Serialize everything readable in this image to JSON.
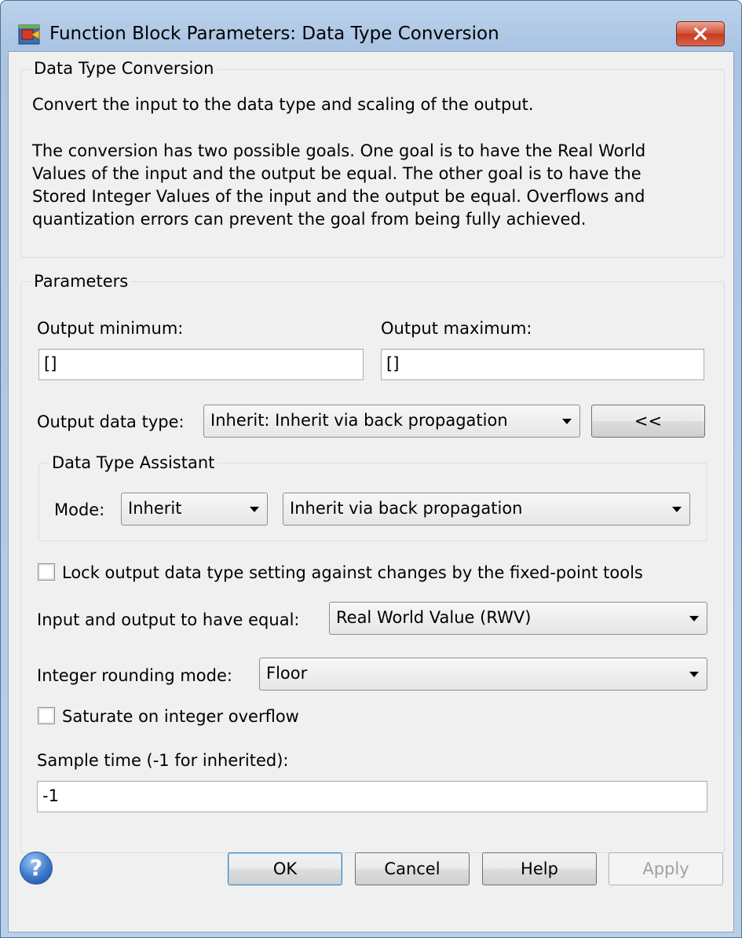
{
  "window": {
    "title": "Function Block Parameters: Data Type Conversion"
  },
  "description_group": {
    "title": "Data Type Conversion",
    "line1": "Convert the input to the data type and scaling of the output.",
    "para2_line1": "The conversion has two possible goals. One goal is to have the Real World",
    "para2_line2": "Values of the input and the output be equal.  The other goal is to have the",
    "para2_line3": "Stored Integer Values of the input and the output be equal.  Overflows and",
    "para2_line4": "quantization errors can prevent the goal from being fully achieved."
  },
  "parameters": {
    "title": "Parameters",
    "output_minimum_label": "Output minimum:",
    "output_minimum_value": "[]",
    "output_maximum_label": "Output maximum:",
    "output_maximum_value": "[]",
    "output_data_type_label": "Output data type:",
    "output_data_type_value": "Inherit: Inherit via back propagation",
    "assistant_toggle_label": "<<",
    "assistant": {
      "title": "Data Type Assistant",
      "mode_label": "Mode:",
      "mode_value": "Inherit",
      "inherit_rule_value": "Inherit via back propagation"
    },
    "lock_checkbox_label": "Lock output data type setting against changes by the fixed-point tools",
    "lock_checked": false,
    "equal_label": "Input and output to have equal:",
    "equal_value": "Real World Value (RWV)",
    "rounding_label": "Integer rounding mode:",
    "rounding_value": "Floor",
    "saturate_label": "Saturate on integer overflow",
    "saturate_checked": false,
    "sample_time_label": "Sample time (-1 for inherited):",
    "sample_time_value": "-1"
  },
  "buttons": {
    "ok": "OK",
    "cancel": "Cancel",
    "help": "Help",
    "apply": "Apply",
    "help_icon_glyph": "?"
  },
  "icons": {
    "app": "simulink-block-icon",
    "close": "close-icon",
    "help": "help-icon"
  }
}
